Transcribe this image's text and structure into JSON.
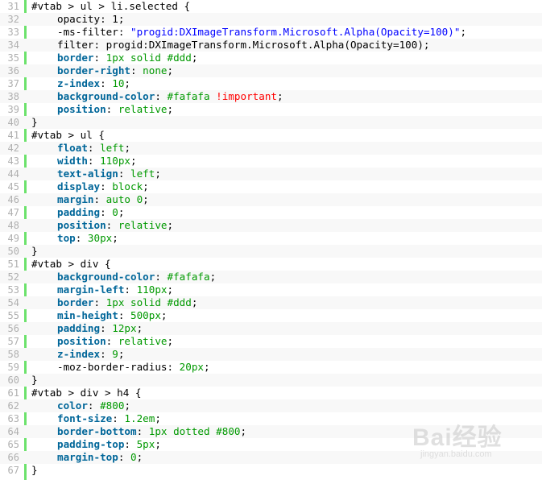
{
  "code": {
    "indent_unit": "    ",
    "lines": [
      {
        "n": "31",
        "tokens": [
          {
            "t": "#vtab > ul > li.selected {",
            "c": "pl"
          }
        ]
      },
      {
        "n": "32",
        "indent": 1,
        "tokens": [
          {
            "t": "opacity: 1;",
            "c": "pl"
          }
        ]
      },
      {
        "n": "33",
        "indent": 1,
        "tokens": [
          {
            "t": "-ms-filter: ",
            "c": "pl"
          },
          {
            "t": "\"progid:DXImageTransform.Microsoft.Alpha(Opacity=100)\"",
            "c": "s"
          },
          {
            "t": ";",
            "c": "pl"
          }
        ]
      },
      {
        "n": "34",
        "indent": 1,
        "tokens": [
          {
            "t": "filter: progid:DXImageTransform.Microsoft.Alpha(Opacity=100);",
            "c": "pl"
          }
        ]
      },
      {
        "n": "35",
        "indent": 1,
        "tokens": [
          {
            "t": "border",
            "c": "kw"
          },
          {
            "t": ": ",
            "c": "pl"
          },
          {
            "t": "1px solid #ddd",
            "c": "v"
          },
          {
            "t": ";",
            "c": "pl"
          }
        ]
      },
      {
        "n": "36",
        "indent": 1,
        "tokens": [
          {
            "t": "border-right",
            "c": "kw"
          },
          {
            "t": ": ",
            "c": "pl"
          },
          {
            "t": "none",
            "c": "v"
          },
          {
            "t": ";",
            "c": "pl"
          }
        ]
      },
      {
        "n": "37",
        "indent": 1,
        "tokens": [
          {
            "t": "z-index",
            "c": "kw"
          },
          {
            "t": ": ",
            "c": "pl"
          },
          {
            "t": "10",
            "c": "v"
          },
          {
            "t": ";",
            "c": "pl"
          }
        ]
      },
      {
        "n": "38",
        "indent": 1,
        "tokens": [
          {
            "t": "background-color",
            "c": "kw"
          },
          {
            "t": ": ",
            "c": "pl"
          },
          {
            "t": "#fafafa",
            "c": "v"
          },
          {
            "t": " ",
            "c": "pl"
          },
          {
            "t": "!important",
            "c": "imp"
          },
          {
            "t": ";",
            "c": "pl"
          }
        ]
      },
      {
        "n": "39",
        "indent": 1,
        "tokens": [
          {
            "t": "position",
            "c": "kw"
          },
          {
            "t": ": ",
            "c": "pl"
          },
          {
            "t": "relative",
            "c": "v"
          },
          {
            "t": ";",
            "c": "pl"
          }
        ]
      },
      {
        "n": "40",
        "tokens": [
          {
            "t": "}",
            "c": "pl"
          }
        ]
      },
      {
        "n": "41",
        "tokens": [
          {
            "t": "#vtab > ul {",
            "c": "pl"
          }
        ]
      },
      {
        "n": "42",
        "indent": 1,
        "tokens": [
          {
            "t": "float",
            "c": "kw"
          },
          {
            "t": ": ",
            "c": "pl"
          },
          {
            "t": "left",
            "c": "v"
          },
          {
            "t": ";",
            "c": "pl"
          }
        ]
      },
      {
        "n": "43",
        "indent": 1,
        "tokens": [
          {
            "t": "width",
            "c": "kw"
          },
          {
            "t": ": ",
            "c": "pl"
          },
          {
            "t": "110px",
            "c": "v"
          },
          {
            "t": ";",
            "c": "pl"
          }
        ]
      },
      {
        "n": "44",
        "indent": 1,
        "tokens": [
          {
            "t": "text-align",
            "c": "kw"
          },
          {
            "t": ": ",
            "c": "pl"
          },
          {
            "t": "left",
            "c": "v"
          },
          {
            "t": ";",
            "c": "pl"
          }
        ]
      },
      {
        "n": "45",
        "indent": 1,
        "tokens": [
          {
            "t": "display",
            "c": "kw"
          },
          {
            "t": ": ",
            "c": "pl"
          },
          {
            "t": "block",
            "c": "v"
          },
          {
            "t": ";",
            "c": "pl"
          }
        ]
      },
      {
        "n": "46",
        "indent": 1,
        "tokens": [
          {
            "t": "margin",
            "c": "kw"
          },
          {
            "t": ": ",
            "c": "pl"
          },
          {
            "t": "auto 0",
            "c": "v"
          },
          {
            "t": ";",
            "c": "pl"
          }
        ]
      },
      {
        "n": "47",
        "indent": 1,
        "tokens": [
          {
            "t": "padding",
            "c": "kw"
          },
          {
            "t": ": ",
            "c": "pl"
          },
          {
            "t": "0",
            "c": "v"
          },
          {
            "t": ";",
            "c": "pl"
          }
        ]
      },
      {
        "n": "48",
        "indent": 1,
        "tokens": [
          {
            "t": "position",
            "c": "kw"
          },
          {
            "t": ": ",
            "c": "pl"
          },
          {
            "t": "relative",
            "c": "v"
          },
          {
            "t": ";",
            "c": "pl"
          }
        ]
      },
      {
        "n": "49",
        "indent": 1,
        "tokens": [
          {
            "t": "top",
            "c": "kw"
          },
          {
            "t": ": ",
            "c": "pl"
          },
          {
            "t": "30px",
            "c": "v"
          },
          {
            "t": ";",
            "c": "pl"
          }
        ]
      },
      {
        "n": "50",
        "tokens": [
          {
            "t": "}",
            "c": "pl"
          }
        ]
      },
      {
        "n": "51",
        "tokens": [
          {
            "t": "#vtab > div {",
            "c": "pl"
          }
        ]
      },
      {
        "n": "52",
        "indent": 1,
        "tokens": [
          {
            "t": "background-color",
            "c": "kw"
          },
          {
            "t": ": ",
            "c": "pl"
          },
          {
            "t": "#fafafa",
            "c": "v"
          },
          {
            "t": ";",
            "c": "pl"
          }
        ]
      },
      {
        "n": "53",
        "indent": 1,
        "tokens": [
          {
            "t": "margin-left",
            "c": "kw"
          },
          {
            "t": ": ",
            "c": "pl"
          },
          {
            "t": "110px",
            "c": "v"
          },
          {
            "t": ";",
            "c": "pl"
          }
        ]
      },
      {
        "n": "54",
        "indent": 1,
        "tokens": [
          {
            "t": "border",
            "c": "kw"
          },
          {
            "t": ": ",
            "c": "pl"
          },
          {
            "t": "1px solid #ddd",
            "c": "v"
          },
          {
            "t": ";",
            "c": "pl"
          }
        ]
      },
      {
        "n": "55",
        "indent": 1,
        "tokens": [
          {
            "t": "min-height",
            "c": "kw"
          },
          {
            "t": ": ",
            "c": "pl"
          },
          {
            "t": "500px",
            "c": "v"
          },
          {
            "t": ";",
            "c": "pl"
          }
        ]
      },
      {
        "n": "56",
        "indent": 1,
        "tokens": [
          {
            "t": "padding",
            "c": "kw"
          },
          {
            "t": ": ",
            "c": "pl"
          },
          {
            "t": "12px",
            "c": "v"
          },
          {
            "t": ";",
            "c": "pl"
          }
        ]
      },
      {
        "n": "57",
        "indent": 1,
        "tokens": [
          {
            "t": "position",
            "c": "kw"
          },
          {
            "t": ": ",
            "c": "pl"
          },
          {
            "t": "relative",
            "c": "v"
          },
          {
            "t": ";",
            "c": "pl"
          }
        ]
      },
      {
        "n": "58",
        "indent": 1,
        "tokens": [
          {
            "t": "z-index",
            "c": "kw"
          },
          {
            "t": ": ",
            "c": "pl"
          },
          {
            "t": "9",
            "c": "v"
          },
          {
            "t": ";",
            "c": "pl"
          }
        ]
      },
      {
        "n": "59",
        "indent": 1,
        "tokens": [
          {
            "t": "-moz-border-radius: ",
            "c": "pl"
          },
          {
            "t": "20px",
            "c": "v"
          },
          {
            "t": ";",
            "c": "pl"
          }
        ]
      },
      {
        "n": "60",
        "tokens": [
          {
            "t": "}",
            "c": "pl"
          }
        ]
      },
      {
        "n": "61",
        "tokens": [
          {
            "t": "#vtab > div > h4 {",
            "c": "pl"
          }
        ]
      },
      {
        "n": "62",
        "indent": 1,
        "tokens": [
          {
            "t": "color",
            "c": "kw"
          },
          {
            "t": ": ",
            "c": "pl"
          },
          {
            "t": "#800",
            "c": "v"
          },
          {
            "t": ";",
            "c": "pl"
          }
        ]
      },
      {
        "n": "63",
        "indent": 1,
        "tokens": [
          {
            "t": "font-size",
            "c": "kw"
          },
          {
            "t": ": ",
            "c": "pl"
          },
          {
            "t": "1.2em",
            "c": "v"
          },
          {
            "t": ";",
            "c": "pl"
          }
        ]
      },
      {
        "n": "64",
        "indent": 1,
        "tokens": [
          {
            "t": "border-bottom",
            "c": "kw"
          },
          {
            "t": ": ",
            "c": "pl"
          },
          {
            "t": "1px dotted #800",
            "c": "v"
          },
          {
            "t": ";",
            "c": "pl"
          }
        ]
      },
      {
        "n": "65",
        "indent": 1,
        "tokens": [
          {
            "t": "padding-top",
            "c": "kw"
          },
          {
            "t": ": ",
            "c": "pl"
          },
          {
            "t": "5px",
            "c": "v"
          },
          {
            "t": ";",
            "c": "pl"
          }
        ]
      },
      {
        "n": "66",
        "indent": 1,
        "tokens": [
          {
            "t": "margin-top",
            "c": "kw"
          },
          {
            "t": ": ",
            "c": "pl"
          },
          {
            "t": "0",
            "c": "v"
          },
          {
            "t": ";",
            "c": "pl"
          }
        ]
      },
      {
        "n": "67",
        "tokens": [
          {
            "t": "}",
            "c": "pl"
          }
        ]
      }
    ]
  },
  "colors": {
    "gutter_bar": "#6ce26c",
    "line_number": "#afafaf",
    "keyword": "#006699",
    "value": "#009900",
    "string": "#0000ff",
    "important": "#ff0000",
    "alt_row": "#f8f8f8"
  },
  "watermark": {
    "brand": "Bai经验",
    "url": "jingyan.baidu.com"
  }
}
